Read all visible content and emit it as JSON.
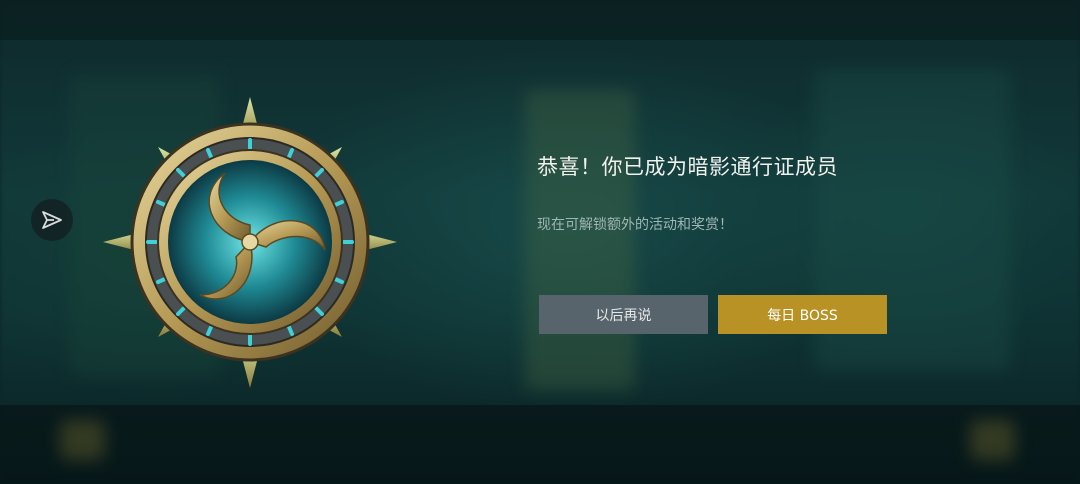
{
  "dialog": {
    "title": "恭喜！你已成为暗影通行证成员",
    "subtitle": "现在可解锁额外的活动和奖赏！",
    "later_button": "以后再说",
    "boss_button": "每日 BOSS"
  },
  "icons": {
    "share": "share-arrow-icon",
    "emblem": "shadow-pass-emblem-icon"
  },
  "colors": {
    "accent_gold": "#b99225",
    "secondary_button": "#58646b",
    "emblem_glow": "#3fd0d8"
  }
}
